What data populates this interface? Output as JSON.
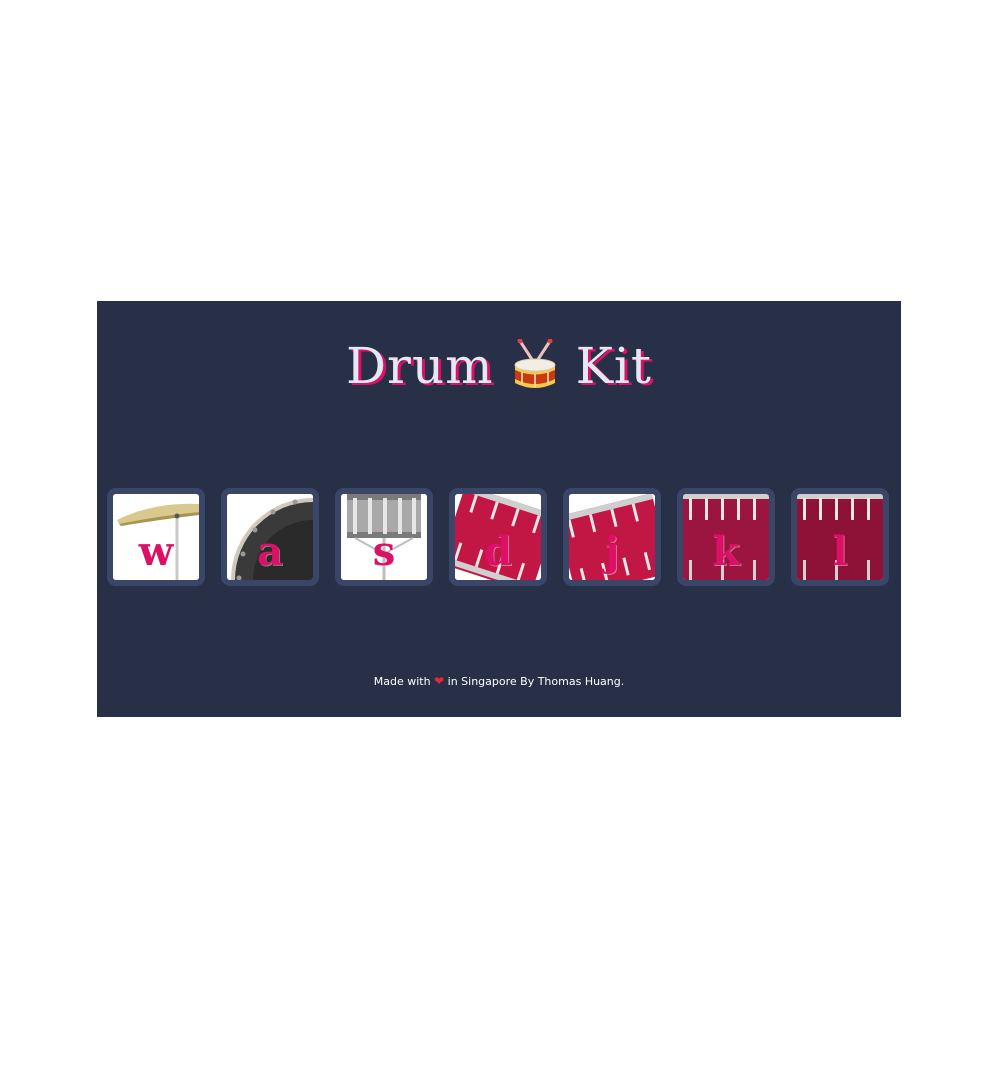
{
  "header": {
    "title_left": "Drum",
    "title_right": "Kit",
    "title_icon": "drum-icon"
  },
  "drums": [
    {
      "letter": "w",
      "name": "crash-cymbal-icon"
    },
    {
      "letter": "a",
      "name": "kick-drum-icon"
    },
    {
      "letter": "s",
      "name": "snare-drum-icon"
    },
    {
      "letter": "d",
      "name": "tom-drum-icon"
    },
    {
      "letter": "j",
      "name": "tom-drum-icon"
    },
    {
      "letter": "k",
      "name": "floor-tom-icon"
    },
    {
      "letter": "l",
      "name": "floor-tom-icon"
    }
  ],
  "footer": {
    "prefix": "Made with",
    "heart": "❤",
    "suffix": "in Singapore By Thomas Huang."
  },
  "colors": {
    "background": "#283048",
    "accent": "#db1066",
    "title_text": "#e4e8f3",
    "key_border": "#3a4668"
  }
}
